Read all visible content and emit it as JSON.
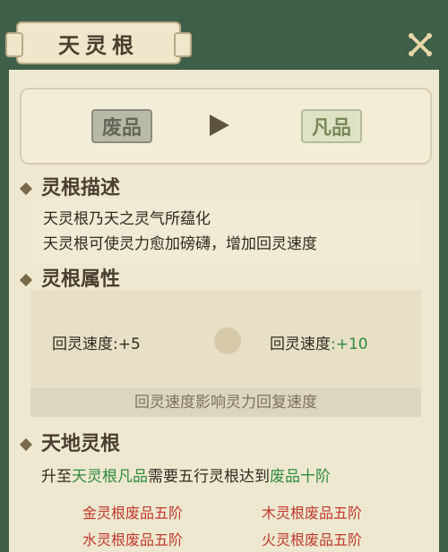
{
  "title": "天灵根",
  "grade": {
    "from": "废品",
    "to": "凡品"
  },
  "sections": {
    "description": "灵根描述",
    "attributes": "灵根属性",
    "tiandi": "天地灵根"
  },
  "description_lines": [
    "天灵根乃天之灵气所蕴化",
    "天灵根可使灵力愈加磅礴，增加回灵速度"
  ],
  "attributes": {
    "left_label": "回灵速度",
    "left_value": ":+5",
    "right_label": "回灵速度",
    "right_value": ":+10",
    "note": "回灵速度影响灵力回复速度"
  },
  "requirement": {
    "prefix": "升至",
    "target": "天灵根凡品",
    "middle": "需要五行灵根达到",
    "level": "废品十阶"
  },
  "req_items": [
    "金灵根废品五阶",
    "木灵根废品五阶",
    "水灵根废品五阶",
    "火灵根废品五阶"
  ]
}
